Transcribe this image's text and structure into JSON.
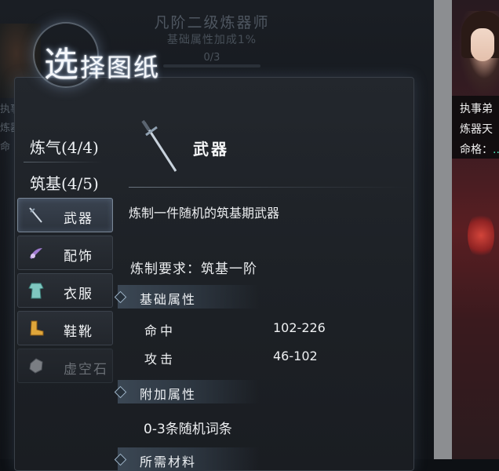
{
  "background": {
    "rank_title": "凡阶二级炼器师",
    "rank_bonus": "基础属性加成1%",
    "progress": "0/3",
    "left_lines": [
      "执事弟子：",
      "炼器天",
      "命"
    ]
  },
  "right_panel": {
    "line1": "执事弟",
    "line2": "炼器天",
    "line3_label": "命格：",
    "line3_value": "..."
  },
  "dialog": {
    "title_first": "选",
    "title_rest": "择图纸",
    "categories": [
      {
        "label": "炼气(4/4)"
      },
      {
        "label": "筑基(4/5)"
      }
    ],
    "items": [
      {
        "label": "武器",
        "icon": "sword-icon",
        "active": true
      },
      {
        "label": "配饰",
        "icon": "accessory-icon",
        "active": false
      },
      {
        "label": "衣服",
        "icon": "clothes-icon",
        "active": false
      },
      {
        "label": "鞋靴",
        "icon": "boots-icon",
        "active": false
      },
      {
        "label": "虚空石",
        "icon": "void-stone-icon",
        "active": false,
        "locked": true
      }
    ]
  },
  "detail": {
    "name": "武器",
    "description": "炼制一件随机的筑基期武器",
    "requirement": "炼制要求：筑基一阶",
    "base_section": "基础属性",
    "stats": [
      {
        "name": "命中",
        "value": "102-226"
      },
      {
        "name": "攻击",
        "value": "46-102"
      }
    ],
    "extra_section": "附加属性",
    "extra_text": "0-3条随机词条",
    "materials_section": "所需材料"
  },
  "colors": {
    "panel_bg": "#1d2126",
    "accent_cyan": "#4fe0b8",
    "highlight_border": "#7a8898"
  }
}
